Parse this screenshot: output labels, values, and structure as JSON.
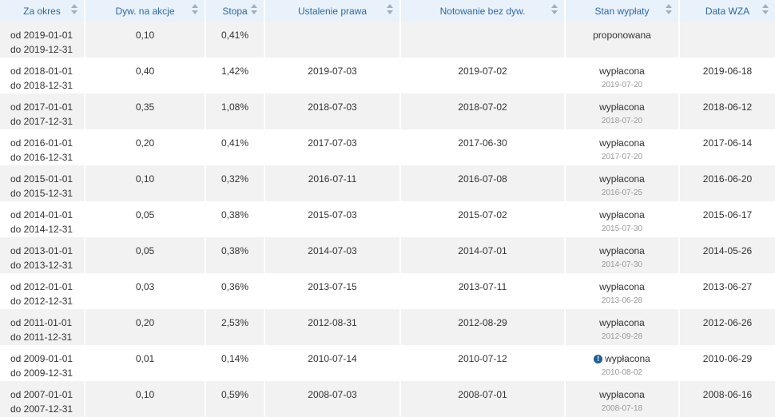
{
  "table": {
    "headers": [
      {
        "label": "Za okres"
      },
      {
        "label": "Dyw. na akcje"
      },
      {
        "label": "Stopa"
      },
      {
        "label": "Ustalenie prawa"
      },
      {
        "label": "Notowanie bez dyw."
      },
      {
        "label": "Stan wypłaty"
      },
      {
        "label": "Data WZA"
      }
    ],
    "rows": [
      {
        "from": "od 2019-01-01",
        "to": "do 2019-12-31",
        "div": "0,10",
        "rate": "0,41%",
        "record": "",
        "exdate": "",
        "status": "proponowana",
        "paid": "",
        "wza": "",
        "warn": false
      },
      {
        "from": "od 2018-01-01",
        "to": "do 2018-12-31",
        "div": "0,40",
        "rate": "1,42%",
        "record": "2019-07-03",
        "exdate": "2019-07-02",
        "status": "wypłacona",
        "paid": "2019-07-20",
        "wza": "2019-06-18",
        "warn": false
      },
      {
        "from": "od 2017-01-01",
        "to": "do 2017-12-31",
        "div": "0,35",
        "rate": "1,08%",
        "record": "2018-07-03",
        "exdate": "2018-07-02",
        "status": "wypłacona",
        "paid": "2018-07-20",
        "wza": "2018-06-12",
        "warn": false
      },
      {
        "from": "od 2016-01-01",
        "to": "do 2016-12-31",
        "div": "0,20",
        "rate": "0,41%",
        "record": "2017-07-03",
        "exdate": "2017-06-30",
        "status": "wypłacona",
        "paid": "2017-07-20",
        "wza": "2017-06-14",
        "warn": false
      },
      {
        "from": "od 2015-01-01",
        "to": "do 2015-12-31",
        "div": "0,10",
        "rate": "0,32%",
        "record": "2016-07-11",
        "exdate": "2016-07-08",
        "status": "wypłacona",
        "paid": "2016-07-25",
        "wza": "2016-06-20",
        "warn": false
      },
      {
        "from": "od 2014-01-01",
        "to": "do 2014-12-31",
        "div": "0,05",
        "rate": "0,38%",
        "record": "2015-07-03",
        "exdate": "2015-07-02",
        "status": "wypłacona",
        "paid": "2015-07-30",
        "wza": "2015-06-17",
        "warn": false
      },
      {
        "from": "od 2013-01-01",
        "to": "do 2013-12-31",
        "div": "0,05",
        "rate": "0,38%",
        "record": "2014-07-03",
        "exdate": "2014-07-01",
        "status": "wypłacona",
        "paid": "2014-07-30",
        "wza": "2014-05-26",
        "warn": false
      },
      {
        "from": "od 2012-01-01",
        "to": "do 2012-12-31",
        "div": "0,03",
        "rate": "0,36%",
        "record": "2013-07-15",
        "exdate": "2013-07-11",
        "status": "wypłacona",
        "paid": "2013-06-28",
        "wza": "2013-06-27",
        "warn": false
      },
      {
        "from": "od 2011-01-01",
        "to": "do 2011-12-31",
        "div": "0,20",
        "rate": "2,53%",
        "record": "2012-08-31",
        "exdate": "2012-08-29",
        "status": "wypłacona",
        "paid": "2012-09-28",
        "wza": "2012-06-26",
        "warn": false
      },
      {
        "from": "od 2009-01-01",
        "to": "do 2009-12-31",
        "div": "0,01",
        "rate": "0,14%",
        "record": "2010-07-14",
        "exdate": "2010-07-12",
        "status": "wypłacona",
        "paid": "2010-08-02",
        "wza": "2010-06-29",
        "warn": true
      },
      {
        "from": "od 2007-01-01",
        "to": "do 2007-12-31",
        "div": "0,10",
        "rate": "0,59%",
        "record": "2008-07-03",
        "exdate": "2008-07-01",
        "status": "wypłacona",
        "paid": "2008-07-18",
        "wza": "2008-06-16",
        "warn": false
      }
    ]
  },
  "icons": {
    "sort": "sort-arrows-icon",
    "warning": "exclamation-circle-icon"
  },
  "warning_glyph": "!",
  "colors": {
    "header_bg": "#e9f1fa",
    "header_text": "#2f6aa5",
    "row_alt": "#f2f2f2",
    "warn_icon": "#1f5f97"
  }
}
